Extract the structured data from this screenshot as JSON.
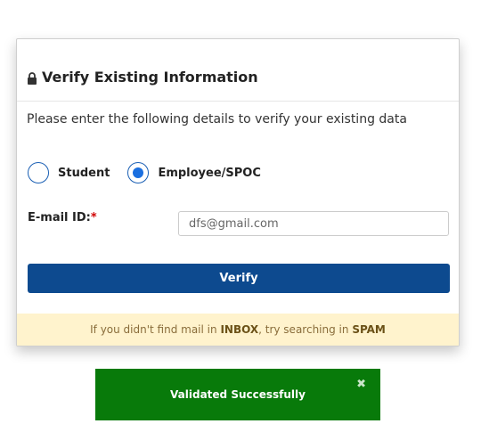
{
  "card": {
    "title": "Verify Existing Information",
    "intro": "Please enter the following details to verify your existing data"
  },
  "user_type": {
    "options": [
      {
        "label": "Student",
        "selected": false
      },
      {
        "label": "Employee/SPOC",
        "selected": true
      }
    ]
  },
  "email": {
    "label": "E-mail ID:",
    "required_mark": "*",
    "value": "dfs@gmail.com"
  },
  "verify_button": {
    "label": "Verify"
  },
  "notice": {
    "prefix": "If you didn't find mail in ",
    "inbox": "INBOX",
    "middle": " , try searching in ",
    "spam": "SPAM"
  },
  "toast": {
    "message": "Validated Successfully",
    "close_glyph": "✖"
  },
  "colors": {
    "primary_button": "#0d4a8f",
    "radio_accent": "#1a6fe0",
    "success_toast": "#087a0a",
    "notice_bg": "#fff3cd",
    "required": "#d00000"
  },
  "icons": {
    "header": "lock-icon",
    "toast_close": "close-icon"
  }
}
